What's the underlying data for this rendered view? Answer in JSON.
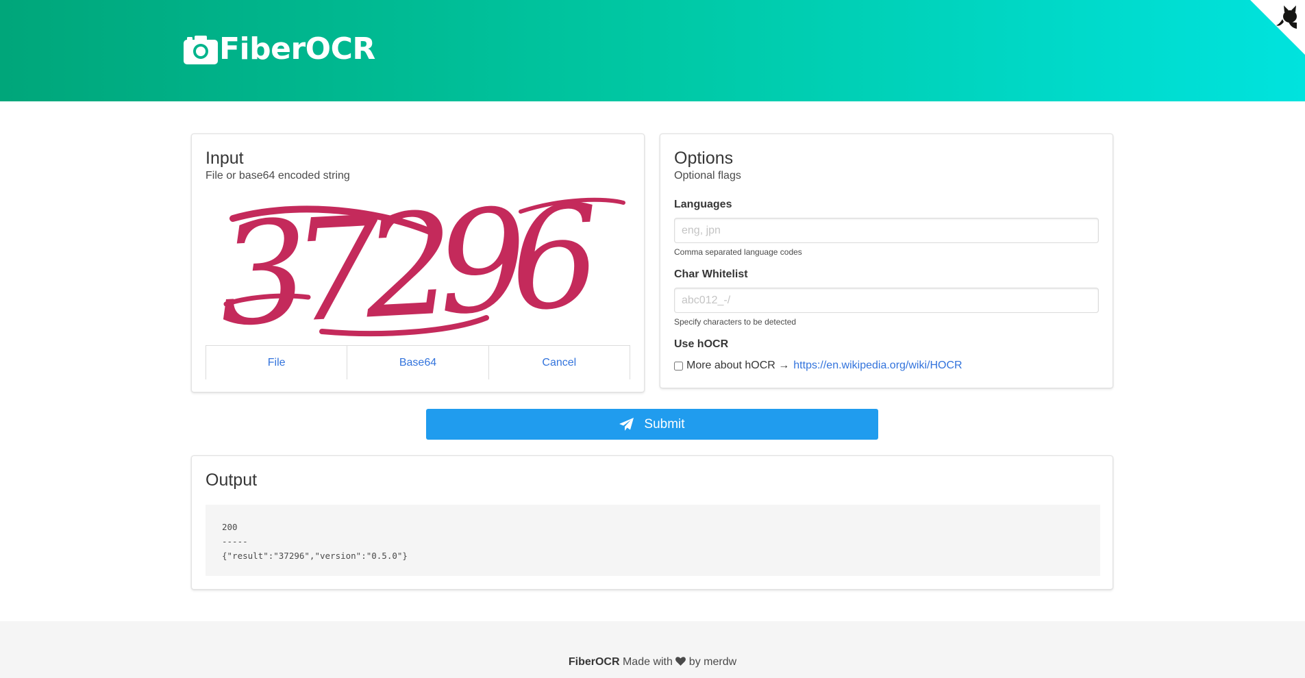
{
  "brand": {
    "title": "FiberOCR",
    "icon": "camera-icon"
  },
  "github_corner": {
    "icon": "github-octocat-icon"
  },
  "input_card": {
    "title": "Input",
    "subtitle": "File or base64 encoded string",
    "preview_text": "37296",
    "buttons": {
      "file": "File",
      "base64": "Base64",
      "cancel": "Cancel"
    }
  },
  "options_card": {
    "title": "Options",
    "subtitle": "Optional flags",
    "languages": {
      "label": "Languages",
      "placeholder": "eng, jpn",
      "value": "",
      "help": "Comma separated language codes"
    },
    "whitelist": {
      "label": "Char Whitelist",
      "placeholder": "abc012_-/",
      "value": "",
      "help": "Specify characters to be detected"
    },
    "hocr": {
      "label": "Use hOCR",
      "checked": false,
      "text": "More about hOCR →",
      "link": "https://en.wikipedia.org/wiki/HOCR"
    }
  },
  "submit": {
    "label": "Submit",
    "icon": "paper-plane-icon"
  },
  "output_card": {
    "title": "Output",
    "content": "200\n-----\n{\"result\":\"37296\",\"version\":\"0.5.0\"}"
  },
  "footer": {
    "brand": "FiberOCR",
    "made_with": "Made with",
    "icon": "heart-icon",
    "by": "by merdw"
  },
  "colors": {
    "hero_start": "#00a67a",
    "hero_end": "#00e3de",
    "primary": "#209cee",
    "link": "#3273dc",
    "captcha": "#c42a5b"
  }
}
